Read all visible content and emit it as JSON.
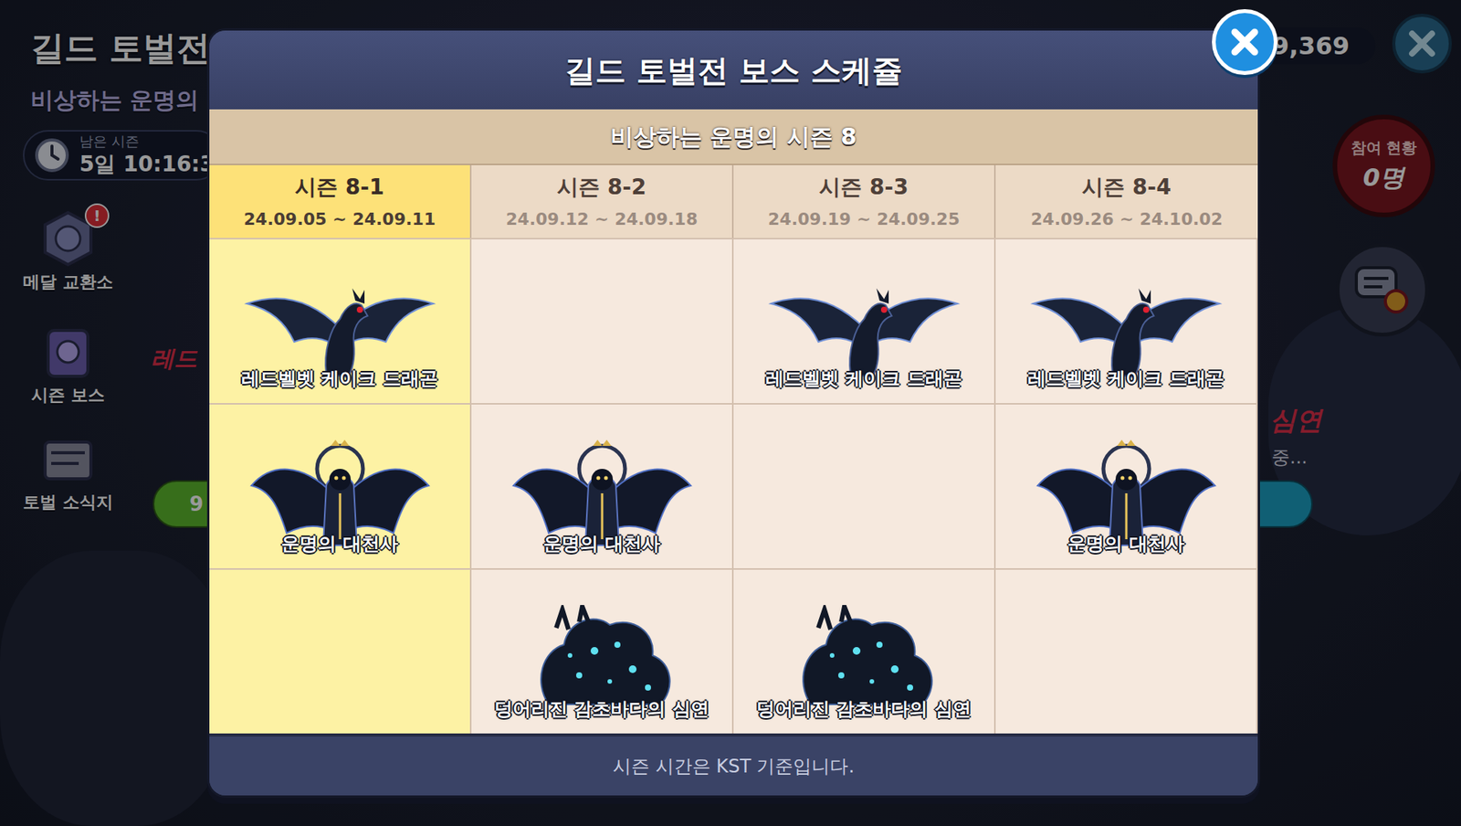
{
  "background": {
    "title": "길드 토벌전",
    "subtitle": "비상하는 운명의",
    "timer_label": "남은 시즌",
    "timer": "5일 10:16:3",
    "side_menu": [
      {
        "label": "메달 교환소",
        "badge": "!"
      },
      {
        "label": "시즌 보스",
        "badge": ""
      },
      {
        "label": "토벌 소식지",
        "badge": ""
      }
    ],
    "behind_left": "레드",
    "behind_right": "심연",
    "behind_right_sub": "중...",
    "button_text": "9",
    "currency": "9,369",
    "participation": {
      "label": "참여 현황",
      "count": "0명"
    }
  },
  "modal": {
    "title": "길드 토벌전 보스 스케쥴",
    "season": "비상하는 운명의 시즌 8",
    "columns": [
      {
        "label": "시즌 8-1",
        "dates": "24.09.05 ~ 24.09.11",
        "selected": true
      },
      {
        "label": "시즌 8-2",
        "dates": "24.09.12 ~ 24.09.18",
        "selected": false
      },
      {
        "label": "시즌 8-3",
        "dates": "24.09.19 ~ 24.09.25",
        "selected": false
      },
      {
        "label": "시즌 8-4",
        "dates": "24.09.26 ~ 24.10.02",
        "selected": false
      }
    ],
    "bosses": [
      {
        "name": "레드벨벳 케이크 드래곤",
        "kind": "dragon",
        "schedule": [
          true,
          false,
          true,
          true
        ]
      },
      {
        "name": "운명의 대천사",
        "kind": "angel",
        "schedule": [
          true,
          true,
          false,
          true
        ]
      },
      {
        "name": "덩어리진 감초바다의 심연",
        "kind": "abyss",
        "schedule": [
          false,
          true,
          true,
          false
        ]
      }
    ],
    "footer": "시즌 시간은 KST 기준입니다."
  }
}
